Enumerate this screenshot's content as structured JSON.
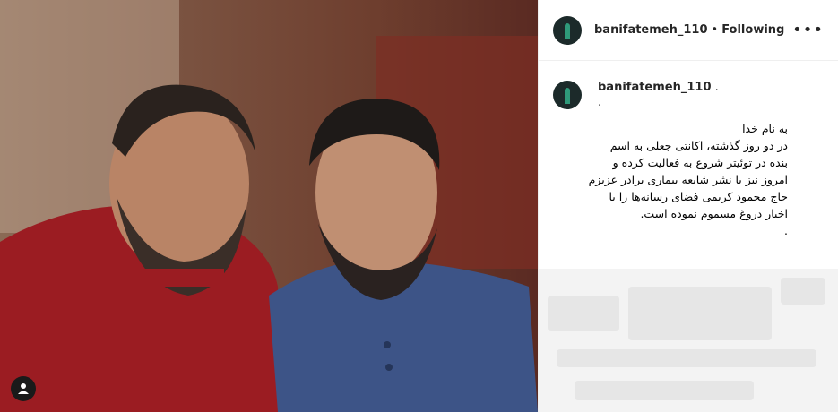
{
  "header": {
    "username": "banifatemeh_110",
    "separator": "•",
    "follow_status": "Following",
    "more_label": "•••"
  },
  "caption": {
    "username": "banifatemeh_110",
    "tail": ".",
    "line0": ".",
    "lines": [
      "به نام خدا",
      "در دو روز گذشته، اکانتی جعلی به اسم",
      "بنده در توئیتر شروع به فعالیت کرده و",
      "امروز نیز با نشر شایعه بیماری برادر عزیزم",
      "حاج محمود کریمی فضای رسانه‌ها را با",
      "اخبار دروغ مسموم نموده است.",
      "."
    ]
  },
  "icons": {
    "tag": "user-tag-icon",
    "more": "more-options-icon"
  },
  "colors": {
    "text": "#262626",
    "border": "#efefef"
  }
}
